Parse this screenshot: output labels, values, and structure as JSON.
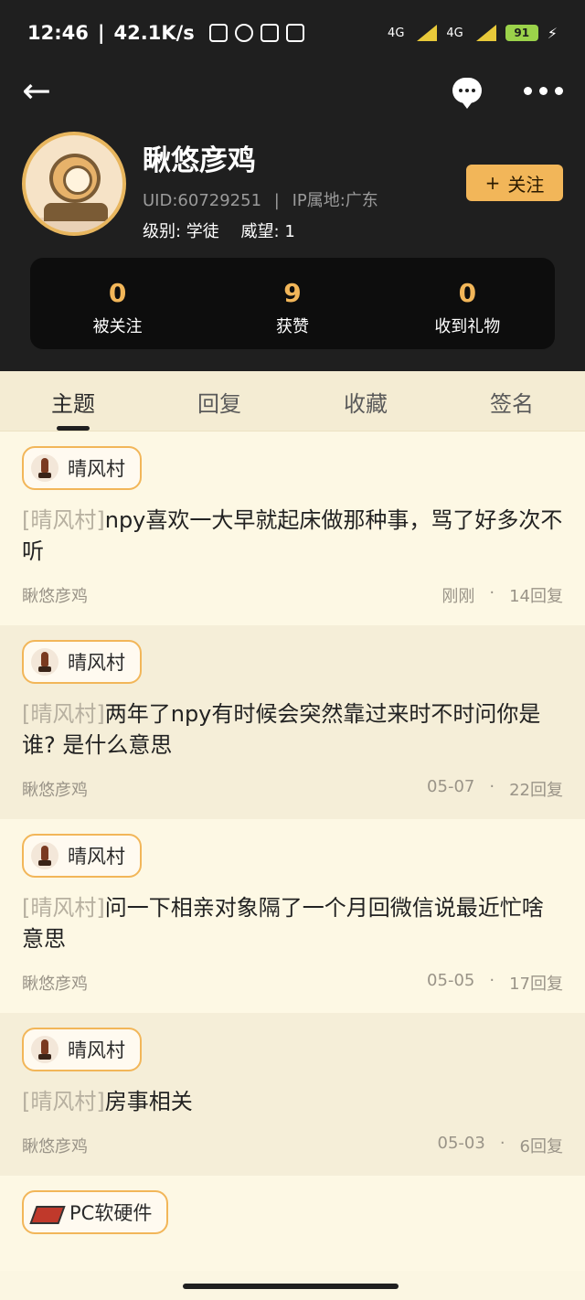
{
  "status": {
    "time": "12:46",
    "speed": "42.1K/s",
    "battery": "91",
    "net1": "4G",
    "net2": "4G"
  },
  "header": {
    "username": "瞅悠彦鸡",
    "uid": "UID:60729251",
    "sep": "|",
    "ip": "IP属地:广东",
    "level_label": "级别: 学徒",
    "prestige_label": "威望: 1",
    "follow_label": "关注",
    "follow_plus": "+"
  },
  "stats": [
    {
      "value": "0",
      "label": "被关注"
    },
    {
      "value": "9",
      "label": "获赞"
    },
    {
      "value": "0",
      "label": "收到礼物"
    }
  ],
  "tabs": [
    {
      "label": "主题"
    },
    {
      "label": "回复"
    },
    {
      "label": "收藏"
    },
    {
      "label": "签名"
    }
  ],
  "posts": [
    {
      "board": "晴风村",
      "tag": "[晴风村]",
      "title": "npy喜欢一大早就起床做那种事，骂了好多次不听",
      "author": "瞅悠彦鸡",
      "time": "刚刚",
      "replies": "14回复"
    },
    {
      "board": "晴风村",
      "tag": "[晴风村]",
      "title": "两年了npy有时候会突然靠过来时不时问你是谁? 是什么意思",
      "author": "瞅悠彦鸡",
      "time": "05-07",
      "replies": "22回复"
    },
    {
      "board": "晴风村",
      "tag": "[晴风村]",
      "title": "问一下相亲对象隔了一个月回微信说最近忙啥意思",
      "author": "瞅悠彦鸡",
      "time": "05-05",
      "replies": "17回复"
    },
    {
      "board": "晴风村",
      "tag": "[晴风村]",
      "title": "房事相关",
      "author": "瞅悠彦鸡",
      "time": "05-03",
      "replies": "6回复"
    },
    {
      "board": "PC软硬件"
    }
  ],
  "dot": "·",
  "icons": [
    "back-arrow-icon",
    "chat-bubble-icon",
    "more-dots-icon",
    "avatar-diving-helmet",
    "board-icon",
    "pc-hardware-icon"
  ],
  "colors": {
    "accent": "#f2b659",
    "header_bg": "#1f1f1f",
    "feed_bg": "#fbf6e2"
  }
}
